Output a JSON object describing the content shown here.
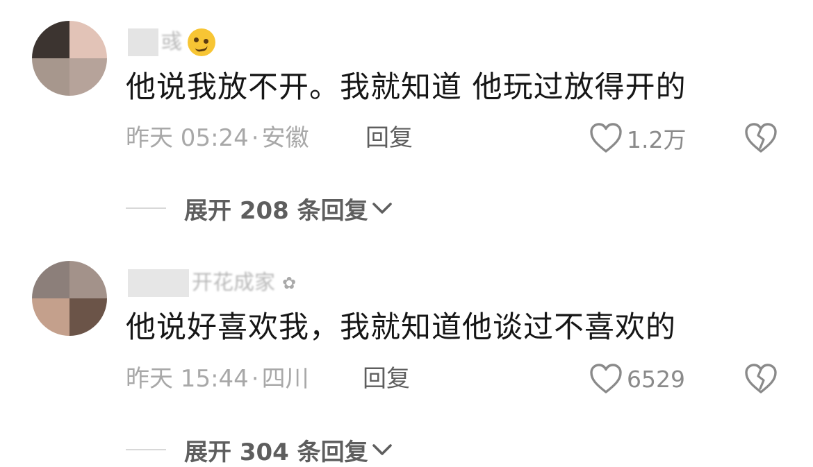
{
  "comments": [
    {
      "username": "彧",
      "content": "他说我放不开。我就知道 他玩过放得开的",
      "time": "昨天 05:24",
      "location": "安徽",
      "reply_label": "回复",
      "likes": "1.2万",
      "expand_label": "展开 208 条回复"
    },
    {
      "username": "开花成家",
      "content": "他说好喜欢我，我就知道他谈过不喜欢的",
      "time": "昨天 15:44",
      "location": "四川",
      "reply_label": "回复",
      "likes": "6529",
      "expand_label": "展开 304 条回复"
    }
  ],
  "meta_separator": "·",
  "colors": {
    "text_primary": "#161616",
    "text_meta": "#a8a8a8",
    "text_action": "#5e5e5e",
    "heart_outline": "#8a8a8a"
  },
  "icons": {
    "like": "heart-outline-icon",
    "dislike": "broken-heart-icon",
    "expand": "chevron-down-icon",
    "badge_1": "woozy-face-emoji-icon",
    "badge_2": "flower-icon"
  }
}
